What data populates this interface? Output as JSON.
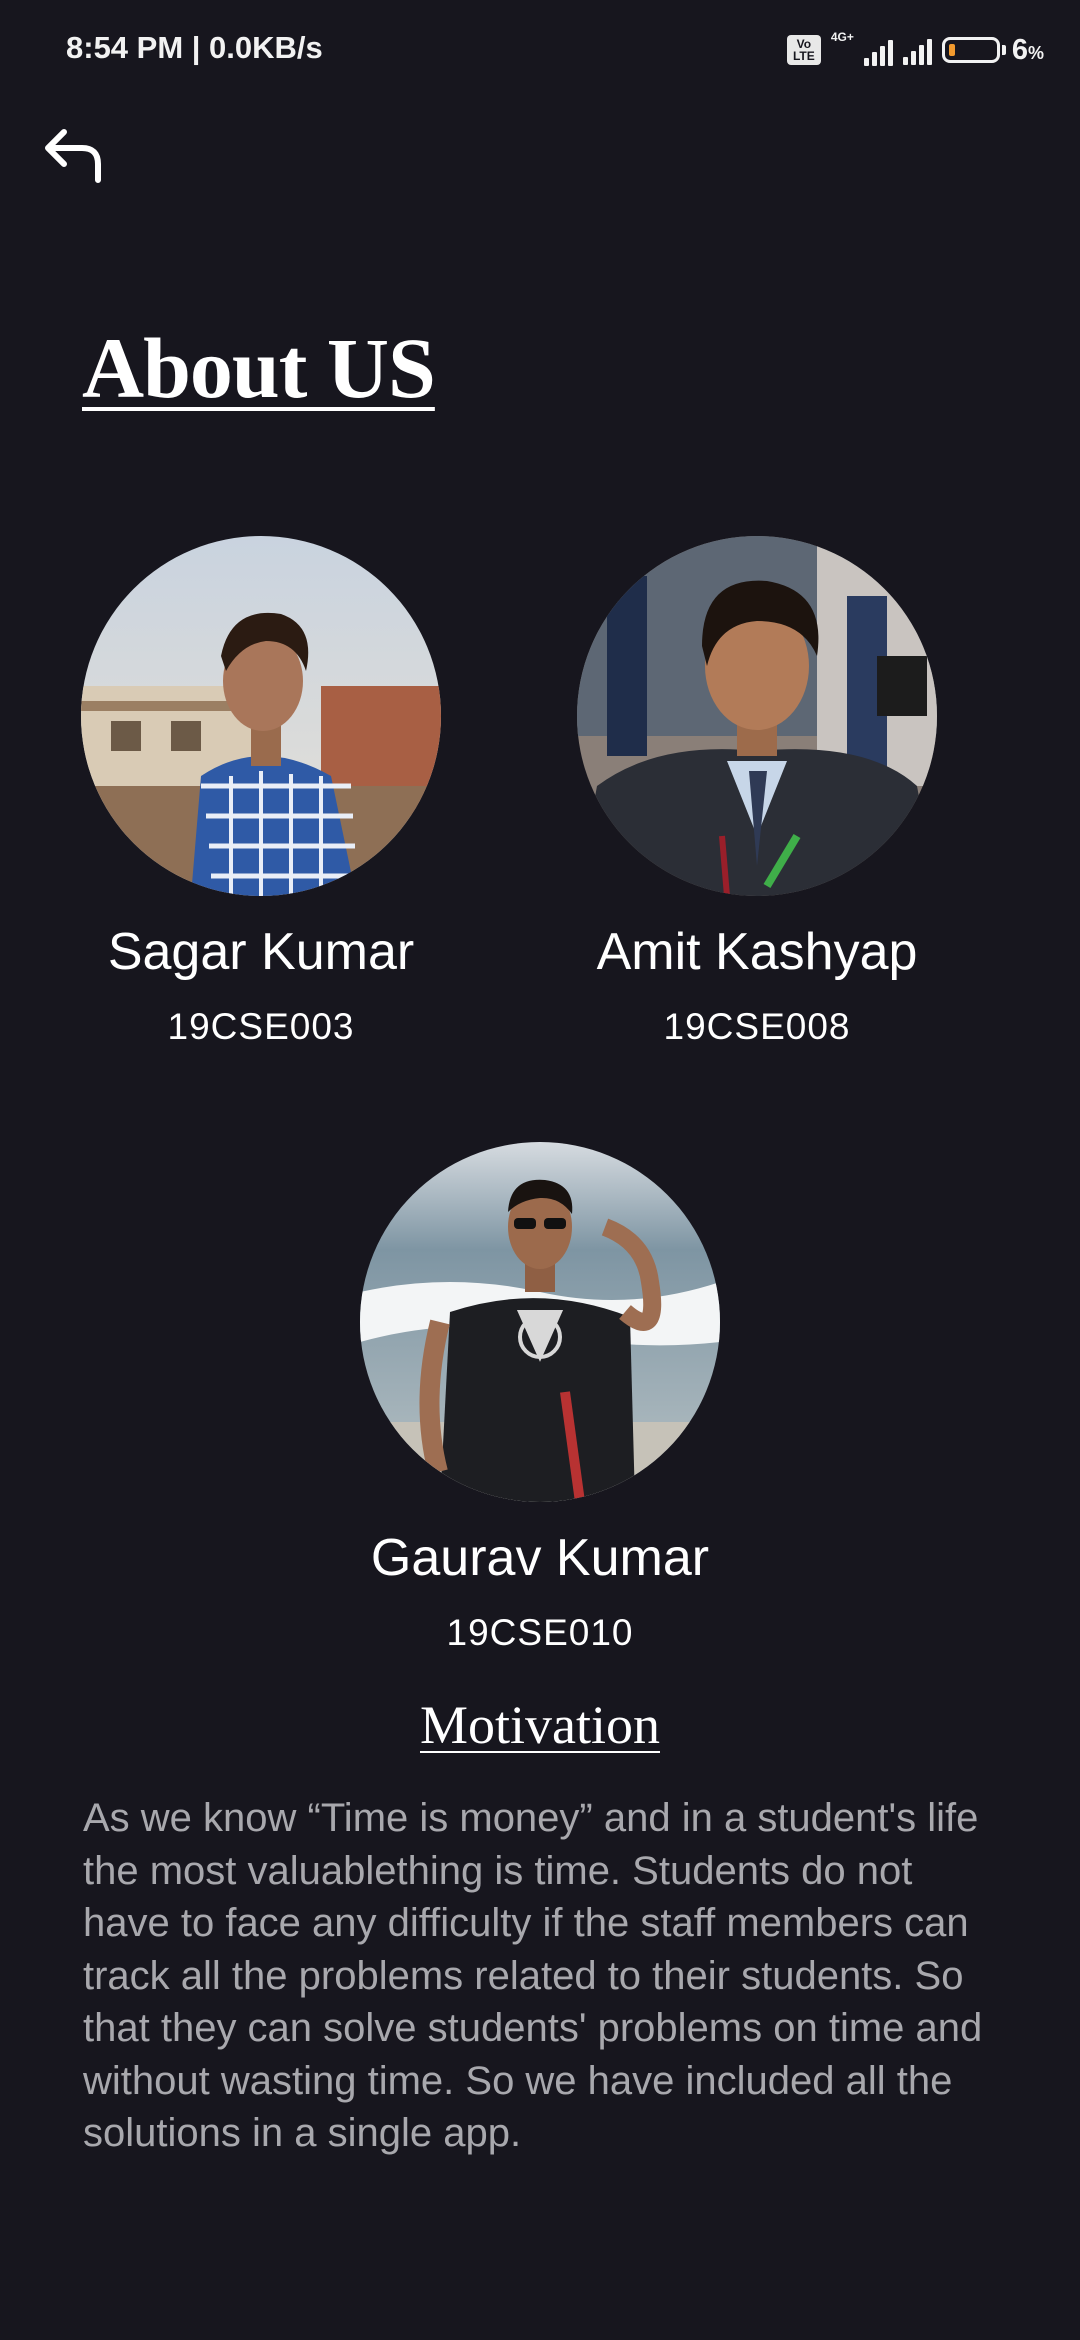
{
  "status_bar": {
    "time": "8:54 PM | 0.0KB/s",
    "volte_label": "Vo LTE",
    "network_label": "4G+",
    "battery_percent": "6",
    "battery_unit": "%"
  },
  "header": {
    "back_icon": "back-arrow-icon"
  },
  "title": "About US",
  "members": [
    {
      "name": "Sagar Kumar",
      "id": "19CSE003"
    },
    {
      "name": "Amit Kashyap",
      "id": "19CSE008"
    },
    {
      "name": "Gaurav Kumar",
      "id": "19CSE010"
    }
  ],
  "motivation": {
    "title": "Motivation",
    "body": "As we know “Time is money” and in a student's life the most valuablething is time. Students do not have to face any difficulty if the staff members can track all the problems related to their students. So that they can solve students' problems on time and without wasting time. So we have included all the solutions in a single app."
  },
  "colors": {
    "background": "#17161e",
    "text": "#ffffff",
    "body_text": "#a8a8ad",
    "battery_low": "#f29a2e"
  }
}
